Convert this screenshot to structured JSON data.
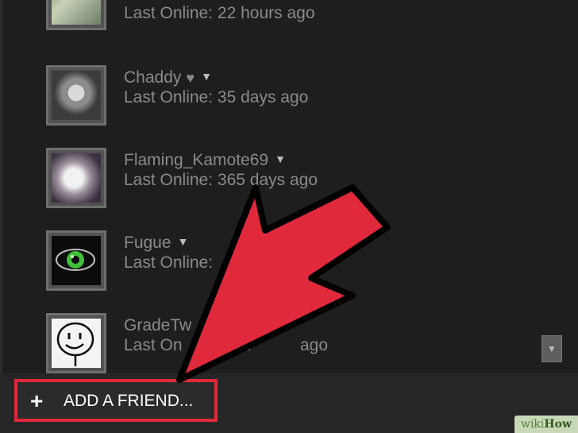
{
  "friends": [
    {
      "name": "",
      "status": "Last Online: 22 hours ago",
      "avatar_icon": "avatar-photo-icon"
    },
    {
      "name": "Chaddy",
      "status": "Last Online: 35 days ago",
      "avatar_icon": "avatar-portrait-icon",
      "badge_icon": "heart-icon"
    },
    {
      "name": "Flaming_Kamote69",
      "status": "Last Online: 365 days ago",
      "avatar_icon": "avatar-portrait-icon"
    },
    {
      "name": "Fugue",
      "status": "Last Online:",
      "avatar_icon": "green-eye-icon"
    },
    {
      "name": "GradeTw",
      "status": "Last On",
      "status_suffix": "o",
      "status_tail": "ago",
      "avatar_icon": "smiley-face-icon"
    }
  ],
  "add_friend": {
    "plus": "+",
    "label": "ADD A FRIEND..."
  },
  "scroll": {
    "down_glyph": "▼"
  },
  "caret": "▼",
  "heart": "♥",
  "watermark": {
    "part1": "wiki",
    "part2": "How"
  },
  "colors": {
    "highlight": "#e0293a",
    "arrow": "#e0293a",
    "panel": "#1e1e1e"
  }
}
